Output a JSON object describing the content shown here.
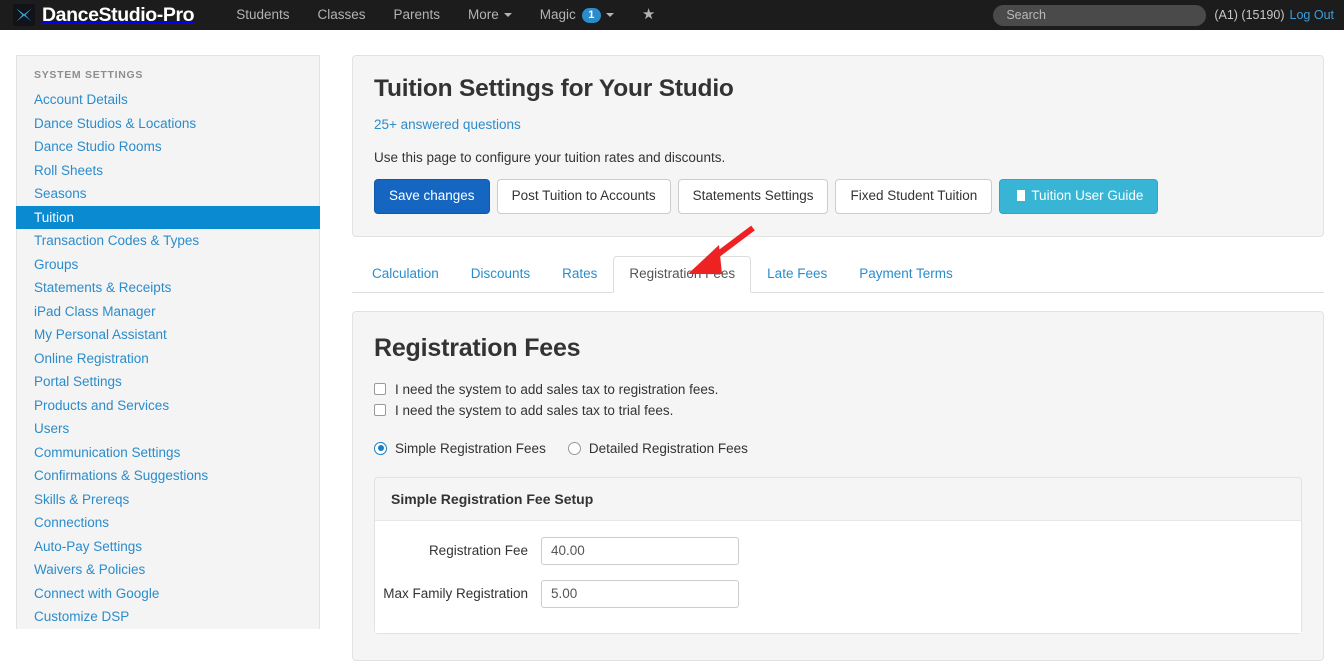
{
  "topnav": {
    "brand": "DanceStudio-Pro",
    "logo_icon": "x-logo-icon",
    "links": [
      {
        "label": "Students",
        "has_caret": false
      },
      {
        "label": "Classes",
        "has_caret": false
      },
      {
        "label": "Parents",
        "has_caret": false
      },
      {
        "label": "More",
        "has_caret": true
      },
      {
        "label": "Magic",
        "has_caret": true,
        "badge": "1"
      }
    ],
    "star_icon": "★",
    "search_placeholder": "Search",
    "search_value": "",
    "account_info": "(A1) (15190)",
    "logout_label": "Log Out"
  },
  "sidebar": {
    "heading": "SYSTEM SETTINGS",
    "items": [
      {
        "label": "Account Details",
        "active": false
      },
      {
        "label": "Dance Studios & Locations",
        "active": false
      },
      {
        "label": "Dance Studio Rooms",
        "active": false
      },
      {
        "label": "Roll Sheets",
        "active": false
      },
      {
        "label": "Seasons",
        "active": false
      },
      {
        "label": "Tuition",
        "active": true
      },
      {
        "label": "Transaction Codes & Types",
        "active": false
      },
      {
        "label": "Groups",
        "active": false
      },
      {
        "label": "Statements & Receipts",
        "active": false
      },
      {
        "label": "iPad Class Manager",
        "active": false
      },
      {
        "label": "My Personal Assistant",
        "active": false
      },
      {
        "label": "Online Registration",
        "active": false
      },
      {
        "label": "Portal Settings",
        "active": false
      },
      {
        "label": "Products and Services",
        "active": false
      },
      {
        "label": "Users",
        "active": false
      },
      {
        "label": "Communication Settings",
        "active": false
      },
      {
        "label": "Confirmations & Suggestions",
        "active": false
      },
      {
        "label": "Skills & Prereqs",
        "active": false
      },
      {
        "label": "Connections",
        "active": false
      },
      {
        "label": "Auto-Pay Settings",
        "active": false
      },
      {
        "label": "Waivers & Policies",
        "active": false
      },
      {
        "label": "Connect with Google",
        "active": false
      },
      {
        "label": "Customize DSP",
        "active": false
      }
    ]
  },
  "hero": {
    "title": "Tuition Settings for Your Studio",
    "questions_link": "25+ answered questions",
    "description": "Use this page to configure your tuition rates and discounts.",
    "buttons": [
      {
        "label": "Save changes",
        "style": "primary"
      },
      {
        "label": "Post Tuition to Accounts",
        "style": "default"
      },
      {
        "label": "Statements Settings",
        "style": "default"
      },
      {
        "label": "Fixed Student Tuition",
        "style": "default"
      },
      {
        "label": "Tuition User Guide",
        "style": "info",
        "icon": "book-icon"
      }
    ]
  },
  "tabs": [
    {
      "label": "Calculation",
      "active": false
    },
    {
      "label": "Discounts",
      "active": false
    },
    {
      "label": "Rates",
      "active": false
    },
    {
      "label": "Registration Fees",
      "active": true
    },
    {
      "label": "Late Fees",
      "active": false
    },
    {
      "label": "Payment Terms",
      "active": false
    }
  ],
  "registration_fees": {
    "heading": "Registration Fees",
    "checkboxes": [
      {
        "label": "I need the system to add sales tax to registration fees.",
        "checked": false
      },
      {
        "label": "I need the system to add sales tax to trial fees.",
        "checked": false
      }
    ],
    "mode_options": [
      {
        "label": "Simple Registration Fees",
        "checked": true
      },
      {
        "label": "Detailed Registration Fees",
        "checked": false
      }
    ],
    "simple_setup": {
      "heading": "Simple Registration Fee Setup",
      "fields": [
        {
          "label": "Registration Fee",
          "value": "40.00"
        },
        {
          "label": "Max Family Registration",
          "value": "5.00"
        }
      ]
    }
  },
  "annotation": {
    "arrow_color": "#ee2222",
    "arrow_target": "Registration Fees tab"
  },
  "colors": {
    "navbar": "#1c1c1c",
    "accent_link": "#2b8ccc",
    "sidebar_active": "#0a8ad1",
    "primary_button": "#1566c0",
    "info_button": "#38b5d4",
    "panel_bg": "#f5f5f5"
  }
}
